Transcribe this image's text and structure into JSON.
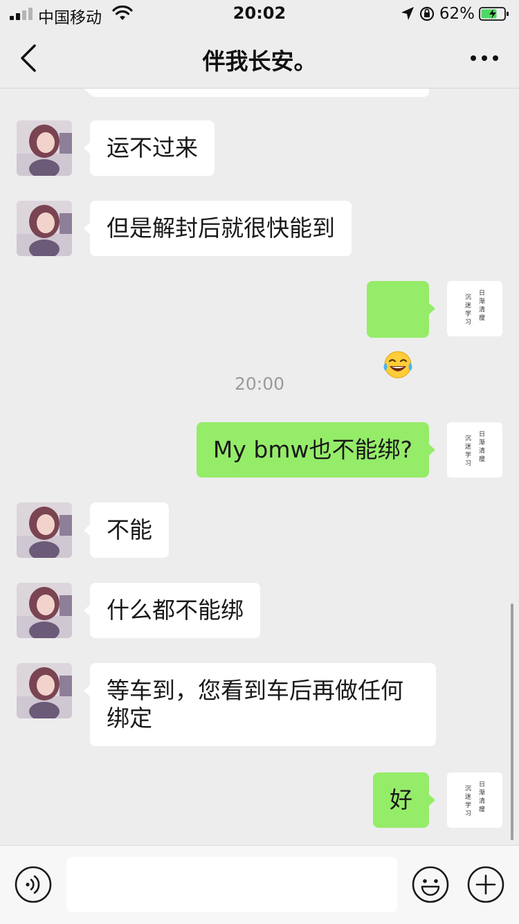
{
  "status_bar": {
    "carrier": "中国移动",
    "time": "20:02",
    "battery_percent": "62%"
  },
  "nav": {
    "title": "伴我长安。"
  },
  "messages": [
    {
      "side": "in",
      "text": "运不过来"
    },
    {
      "side": "in",
      "text": "但是解封后就很快能到"
    },
    {
      "side": "out",
      "text": "😂"
    },
    {
      "side": "out",
      "text": "My bmw也不能绑?"
    },
    {
      "side": "in",
      "text": "不能"
    },
    {
      "side": "in",
      "text": "什么都不能绑"
    },
    {
      "side": "in",
      "text": "等车到，您看到车后再做任何\n绑定"
    },
    {
      "side": "out",
      "text": "好"
    }
  ],
  "timestamp": "20:00",
  "my_avatar_text": [
    "日",
    "渐",
    "清",
    "瘦",
    "沉",
    "迷",
    "学",
    "习"
  ],
  "colors": {
    "background": "#ededed",
    "incoming_bubble": "#ffffff",
    "outgoing_bubble": "#95ec69",
    "timestamp": "#9a9a9a"
  },
  "icons": {
    "back": "chevron-left-icon",
    "more": "more-dots-icon",
    "voice": "voice-icon",
    "emoji": "emoji-icon",
    "plus": "plus-icon"
  }
}
